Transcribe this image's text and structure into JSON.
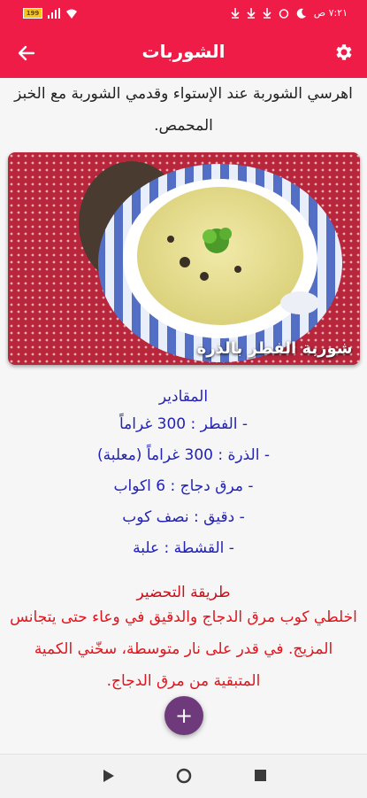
{
  "status_bar": {
    "battery_label": "199",
    "time": "٧:٢١ ص",
    "icons": [
      "battery-icon",
      "signal-icon",
      "wifi-icon",
      "download-icon",
      "download-icon",
      "download-icon",
      "alarm-icon",
      "dnd-icon"
    ]
  },
  "app_bar": {
    "title": "الشوربات",
    "settings_icon": "gear-icon",
    "back_icon": "arrow-back-icon"
  },
  "recipe": {
    "intro": "اهرسي الشوربة عند الإستواء وقدمي الشوربة مع الخبز المحمص.",
    "image_caption": "شوربة الفطر بالذرة",
    "ingredients_title": "المقادير",
    "ingredients": [
      "- الفطر : 300 غراماً",
      "- الذرة : 300 غراماً (معلبة)",
      "- مرق دجاج : 6 اكواب",
      "- دقيق : نصف كوب",
      "- القشطة : علبة"
    ],
    "preparation_title": "طريقة التحضير",
    "preparation_text": "اخلطي كوب مرق الدجاج والدقيق في وعاء حتى يتجانس المزيج. في قدر على نار متوسطة، سخّني الكمية المتبقية من مرق الدجاج."
  },
  "fab": {
    "label": "+",
    "icon": "plus-icon"
  },
  "nav_bar": {
    "icons": [
      "play-icon",
      "home-circle-icon",
      "square-icon"
    ]
  },
  "colors": {
    "accent": "#ee1c46",
    "ingredients": "#2323b6",
    "preparation": "#e0151d",
    "fab": "#6f3a7b"
  }
}
